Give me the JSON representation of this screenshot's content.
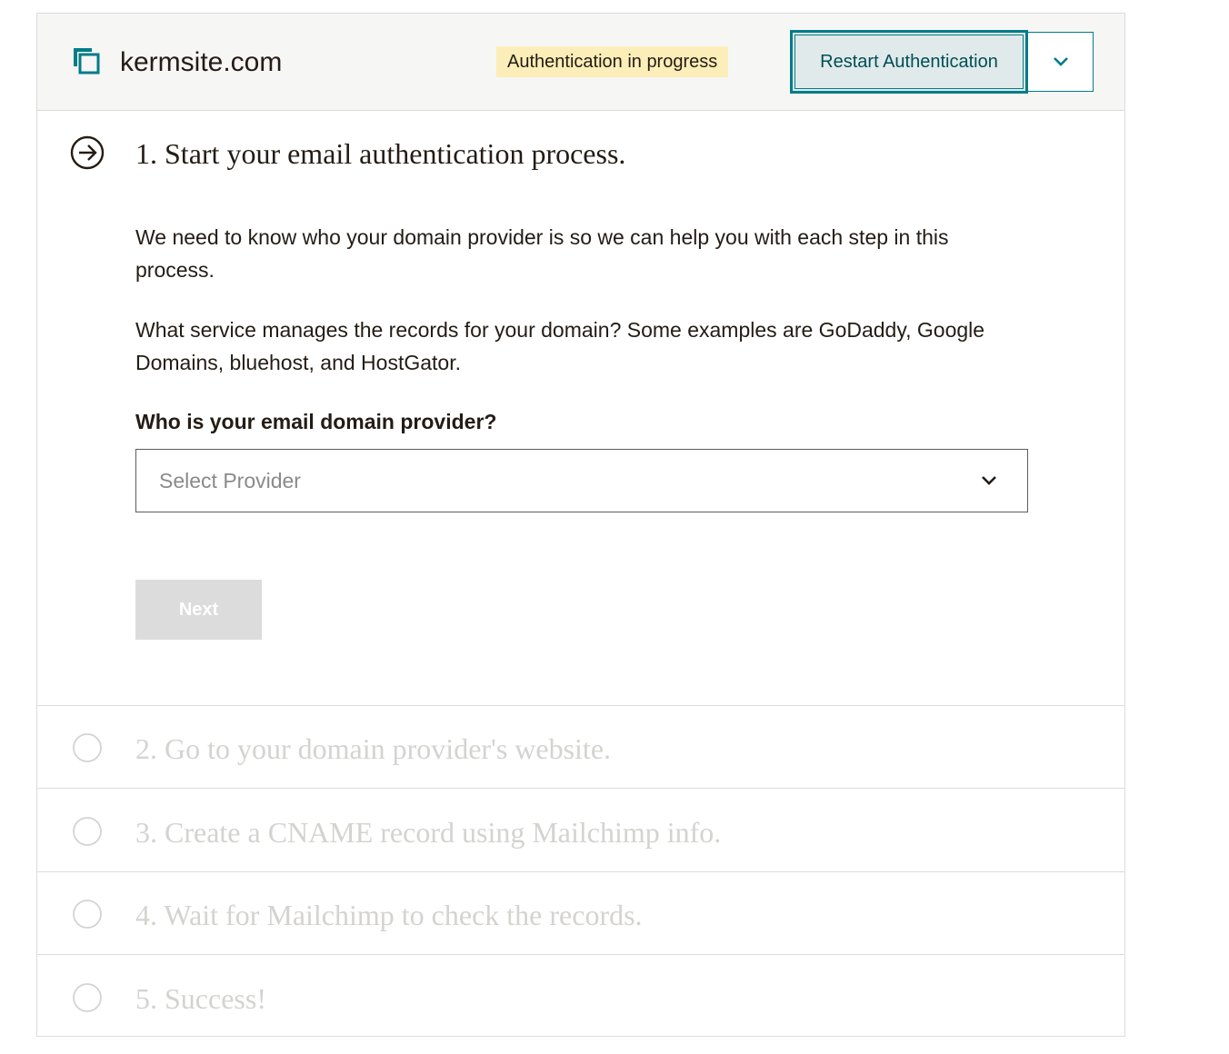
{
  "header": {
    "domain": "kermsite.com",
    "status_badge": "Authentication in progress",
    "restart_label": "Restart Authentication",
    "menu_icon": "chevron-down-icon",
    "domain_icon": "domain-stack-icon",
    "colors": {
      "accent": "#007c89",
      "badge_bg": "#fbeeb8",
      "header_bg": "#f6f6f4"
    }
  },
  "steps": [
    {
      "title": "1. Start your email authentication process.",
      "icon": "arrow-right-circle-icon",
      "state": "active",
      "paragraphs": [
        "We need to know who your domain provider is so we can help you with each step in this process.",
        "What service manages the records for your domain? Some examples are GoDaddy, Google Domains, bluehost, and HostGator."
      ],
      "field_label": "Who is your email domain provider?",
      "select_placeholder": "Select Provider",
      "next_label": "Next"
    },
    {
      "title": "2. Go to your domain provider's website.",
      "icon": "empty-circle-icon",
      "state": "disabled"
    },
    {
      "title": "3. Create a CNAME record using Mailchimp info.",
      "icon": "empty-circle-icon",
      "state": "disabled"
    },
    {
      "title": "4. Wait for Mailchimp to check the records.",
      "icon": "empty-circle-icon",
      "state": "disabled"
    },
    {
      "title": "5. Success!",
      "icon": "empty-circle-icon",
      "state": "disabled"
    }
  ]
}
